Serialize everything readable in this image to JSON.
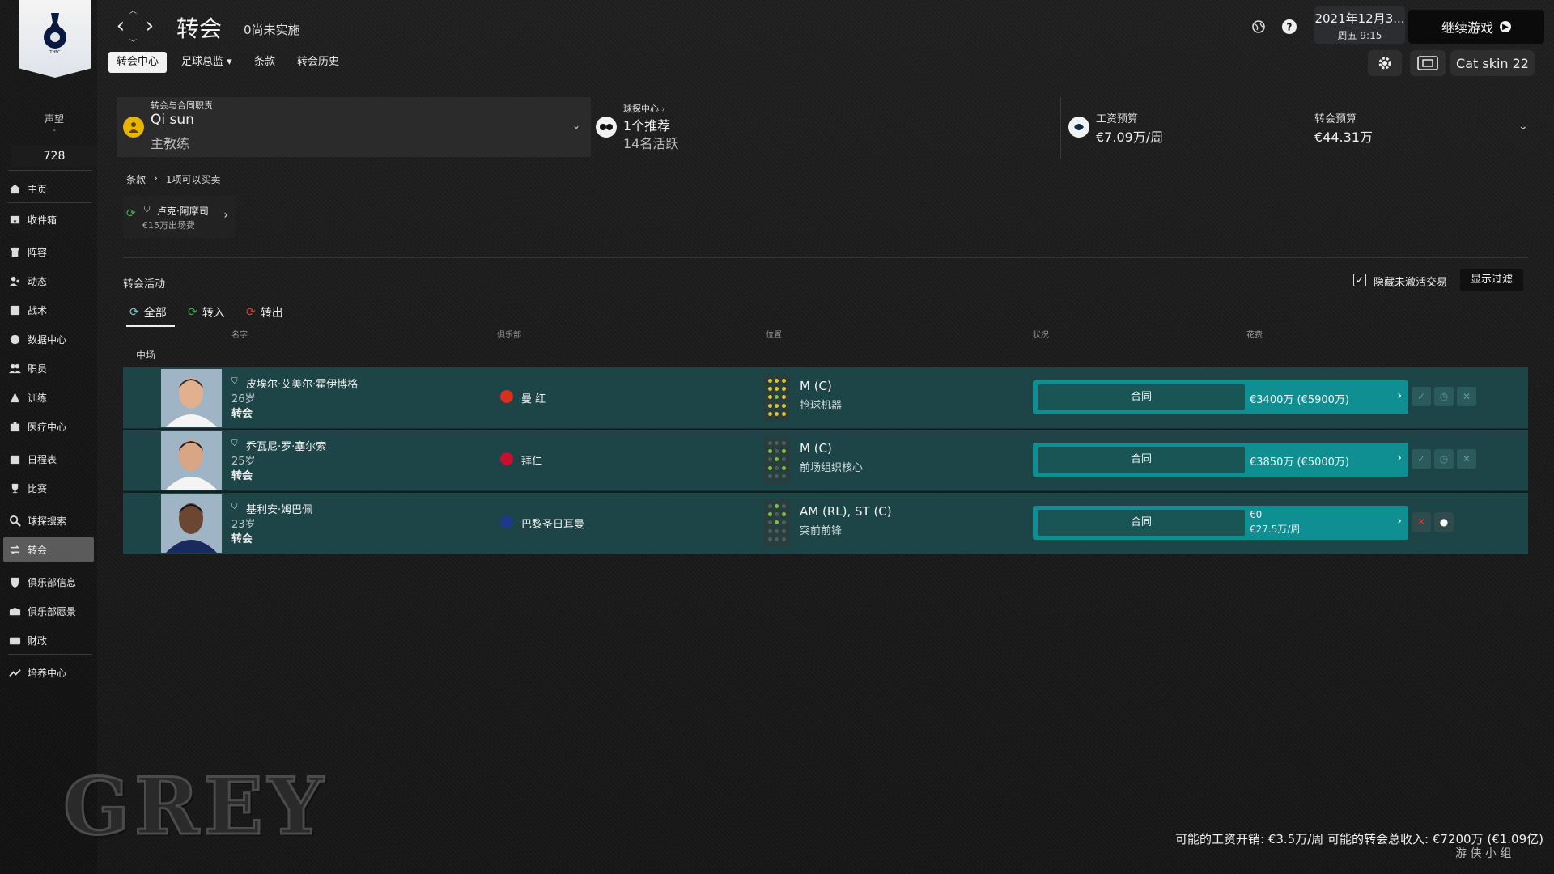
{
  "sidebar": {
    "reputation_label": "声望",
    "reputation_dash": "-",
    "reputation_value": "728",
    "items": [
      {
        "label": "主页",
        "icon": "home-icon"
      },
      {
        "label": "收件箱",
        "icon": "inbox-icon"
      },
      {
        "label": "阵容",
        "icon": "squad-icon"
      },
      {
        "label": "动态",
        "icon": "dynamics-icon"
      },
      {
        "label": "战术",
        "icon": "tactics-icon"
      },
      {
        "label": "数据中心",
        "icon": "data-hub-icon"
      },
      {
        "label": "职员",
        "icon": "staff-icon"
      },
      {
        "label": "训练",
        "icon": "training-icon"
      },
      {
        "label": "医疗中心",
        "icon": "medical-icon"
      },
      {
        "label": "日程表",
        "icon": "calendar-icon"
      },
      {
        "label": "比赛",
        "icon": "trophy-icon"
      },
      {
        "label": "球探搜索",
        "icon": "search-icon"
      },
      {
        "label": "转会",
        "icon": "transfers-icon"
      },
      {
        "label": "俱乐部信息",
        "icon": "shield-icon"
      },
      {
        "label": "俱乐部愿景",
        "icon": "vision-icon"
      },
      {
        "label": "财政",
        "icon": "finance-icon"
      },
      {
        "label": "培养中心",
        "icon": "development-icon"
      }
    ],
    "active_index": 12,
    "bottom_logo": "GREY"
  },
  "header": {
    "title": "转会",
    "subtitle": "0尚未实施",
    "tabs": [
      "转会中心",
      "足球总监",
      "条款",
      "转会历史"
    ],
    "tab_dropdown": "▾",
    "date_line1": "2021年12月3...",
    "date_line2": "周五 9:15",
    "continue_label": "继续游戏",
    "skin_label": "Cat skin 22"
  },
  "summary": {
    "duties_label": "转会与合同职责",
    "manager_name": "Qi sun",
    "manager_role": "主教练",
    "scouting_label": "球探中心 ›",
    "recommendations": "1个推荐",
    "active": "14名活跃",
    "wage_label": "工资预算",
    "wage_value": "€7.09万/周",
    "transfer_label": "转会预算",
    "transfer_value": "€44.31万"
  },
  "clauses": {
    "crumb_a": "条款",
    "crumb_sep": "›",
    "crumb_b": "1项可以买卖",
    "card_name": "卢克·阿摩司",
    "card_fee": "€15万出场费"
  },
  "activity": {
    "title": "转会活动",
    "tabs": [
      "全部",
      "转入",
      "转出"
    ],
    "hide_inactive_label": "隐藏未激活交易",
    "show_filter": "显示过滤",
    "checkmark": "✓",
    "columns": [
      "名字",
      "俱乐部",
      "位置",
      "状况",
      "花费"
    ],
    "group": "中场",
    "rows": [
      {
        "name": "皮埃尔·艾美尔·霍伊博格",
        "age": "26岁",
        "type": "转会",
        "club": "曼 红",
        "position": "M (C)",
        "role": "抢球机器",
        "status": "合同",
        "fee": "€3400万 (€5900万)",
        "fee_line2": "",
        "club_color": "#d6301f"
      },
      {
        "name": "乔瓦尼·罗·塞尔索",
        "age": "25岁",
        "type": "转会",
        "club": "拜仁",
        "position": "M (C)",
        "role": "前场组织核心",
        "status": "合同",
        "fee": "€3850万 (€5000万)",
        "fee_line2": "",
        "club_color": "#c8102e"
      },
      {
        "name": "基利安·姆巴佩",
        "age": "23岁",
        "type": "转会",
        "club": "巴黎圣日耳曼",
        "position": "AM (RL), ST (C)",
        "role": "突前前锋",
        "status": "合同",
        "fee": "€0",
        "fee_line2": "€27.5万/周",
        "club_color": "#1b3a8a"
      }
    ]
  },
  "footer": {
    "stats": "可能的工资开销: €3.5万/周 可能的转会总收入: €7200万 (€1.09亿)",
    "watermark": "游 侠 小 组"
  },
  "colors": {
    "row_bg": "#1d4446",
    "status_accent": "#0f8f92",
    "background": "#191919"
  }
}
